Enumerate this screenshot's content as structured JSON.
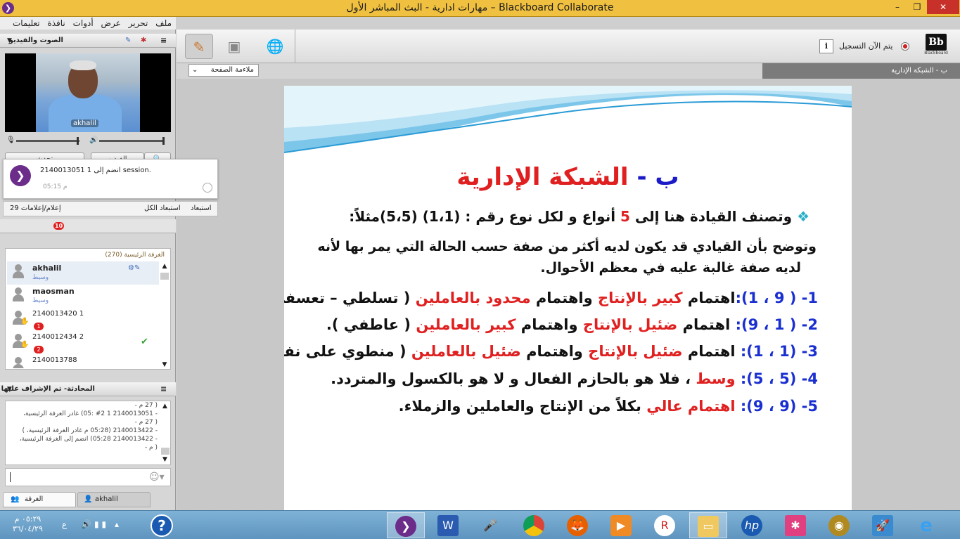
{
  "window": {
    "title": "مهارات ادارية - البث المباشر الأول – Blackboard Collaborate",
    "min": "–",
    "max": "❐",
    "close": "✕"
  },
  "menu": [
    "ملف",
    "تحرير",
    "عرض",
    "أدوات",
    "نافذة",
    "تعليمات"
  ],
  "audio_video": {
    "header": "الصوت والفيديو",
    "video_tag": "akhalil",
    "talk_button": "تحدث",
    "video_button": "الفيديو"
  },
  "notification": {
    "message": "2140013051 1 انضم إلى session.",
    "time": "05:15 م"
  },
  "dismiss_bar": {
    "count_label": "29 إعلام/إعلامات",
    "dismiss": "استبعاد",
    "dismiss_all": "استبعاد الكل"
  },
  "participants": {
    "room_label": "الغرفة الرئيسية (270)",
    "raised_hands_badge": "10",
    "rows": [
      {
        "name": "akhalil",
        "role": "وسيط",
        "badge": ""
      },
      {
        "name": "maosman",
        "role": "وسيط",
        "badge": ""
      },
      {
        "name": "2140013420 1",
        "role": "",
        "badge": "1"
      },
      {
        "name": "2140012434 2",
        "role": "",
        "badge": "2"
      },
      {
        "name": "2140013788",
        "role": "",
        "badge": ""
      }
    ]
  },
  "chat": {
    "header": "المحادثة- تم الإشراف عليها",
    "messages": [
      "( 27 م -",
      "- 2140013051 1 #2 :05) غادر الغرفة الرئيسية،",
      "( 27 م -",
      "- 2140013422 (05:28 م غادر الغرفة الرئيسية، )",
      "- 2140013422 05:28) انضم إلى الغرفة الرئيسية،",
      "( م -"
    ]
  },
  "bottom_tabs": {
    "room": "الغرفة",
    "user": "akhalil"
  },
  "toolbar": {
    "recording_text": "يتم الآن التسجيل",
    "info": "i",
    "brand_mark": "Bb",
    "brand_sub": "Blackboard"
  },
  "subbar": {
    "fit": "ملاءمة الصفحة",
    "slide_tab": "ب - الشبكة الإدارية"
  },
  "slide": {
    "title_prefix": "ب -",
    "title_main": "الشبكة الإدارية",
    "bullet": "❖",
    "intro_a": "وتصنف القيادة هنا إلى ",
    "intro_five": "5",
    "intro_b": " أنواع و لكل نوع  رقم : (1،1) (5،5)مثلاً:",
    "explain1": "وتوضح بأن القيادي قد يكون لديه أكثر من صفة حسب الحالة التي يمر بها  لأنه",
    "explain2": "لديه صفة غالبة عليه في معظم الأحوال.",
    "items": [
      {
        "num": "1- ( 9 ، 1):",
        "t1": "اهتمام ",
        "r1": "كبير بالإنتاج",
        "t2": " واهتمام ",
        "r2": "محدود بالعاملين",
        "t3": " ( تسلطي – تعسفي )."
      },
      {
        "num": "2- ( 1 ، 9):",
        "t1": " اهتمام ",
        "r1": "ضئيل بالإنتاج",
        "t2": " واهتمام ",
        "r2": "كبير بالعاملين",
        "t3": " ( عاطفي )."
      },
      {
        "num": "3- (1 ، 1):",
        "t1": " اهتمام ",
        "r1": "ضئيل بالإنتاج",
        "t2": " واهتمام ",
        "r2": "ضئيل بالعاملين",
        "t3": " ( منطوي على نفسه)."
      },
      {
        "num": "4- (5 ، 5):",
        "t1": " ",
        "r1": "وسط",
        "t2": " ،  فلا هو بالحازم الفعال و لا هو بالكسول والمتردد.",
        "r2": "",
        "t3": ""
      },
      {
        "num": "5- (9 ، 9):",
        "t1": " ",
        "r1": "اهتمام عالي",
        "t2": " بكلاً من الإنتاج والعاملين والزملاء.",
        "r2": "",
        "t3": ""
      }
    ]
  },
  "taskbar": {
    "time": "٠٥:٢٩ م",
    "date": "٣٦/٠٤/٢٩",
    "lang": "ع",
    "help": "?"
  },
  "colors": {
    "titlebar": "#f0c040",
    "slide_title": "#e02020",
    "slide_blue": "#1a2fd0",
    "collaborate_purple": "#6b2c8a"
  }
}
